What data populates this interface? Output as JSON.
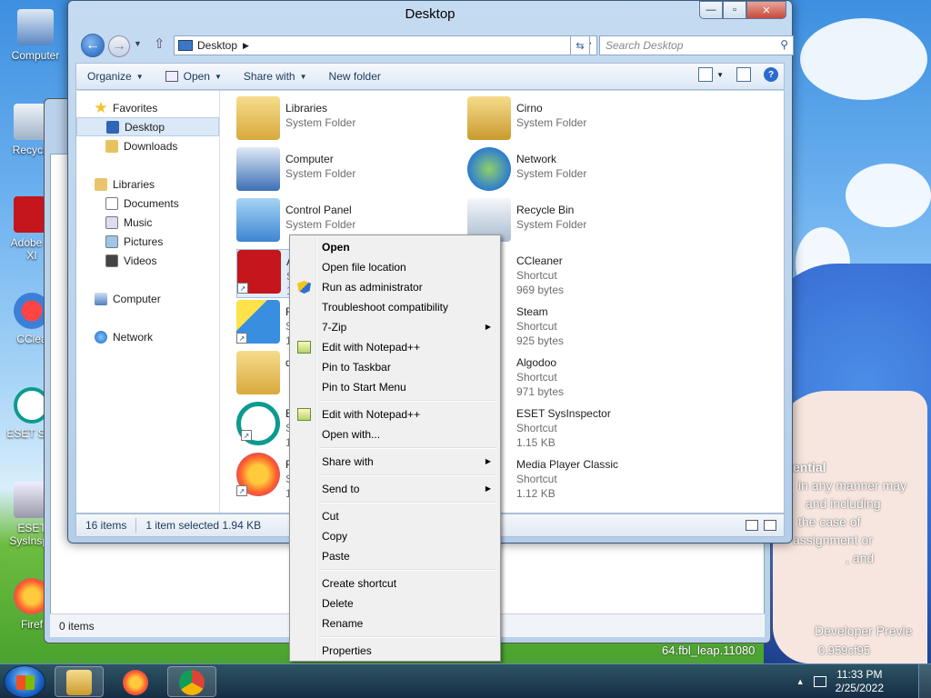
{
  "window": {
    "title": "Desktop",
    "address": "Desktop",
    "search_placeholder": "Search Desktop"
  },
  "toolbar": {
    "organize": "Organize",
    "open": "Open",
    "share_with": "Share with",
    "new_folder": "New folder"
  },
  "nav": {
    "favorites": "Favorites",
    "desktop": "Desktop",
    "downloads": "Downloads",
    "libraries": "Libraries",
    "documents": "Documents",
    "music": "Music",
    "pictures": "Pictures",
    "videos": "Videos",
    "computer": "Computer",
    "network": "Network"
  },
  "files": [
    {
      "name": "Libraries",
      "type": "System Folder",
      "size": ""
    },
    {
      "name": "Cirno",
      "type": "System Folder",
      "size": ""
    },
    {
      "name": "Computer",
      "type": "System Folder",
      "size": ""
    },
    {
      "name": "Network",
      "type": "System Folder",
      "size": ""
    },
    {
      "name": "Control Panel",
      "type": "System Folder",
      "size": ""
    },
    {
      "name": "Recycle Bin",
      "type": "System Folder",
      "size": ""
    },
    {
      "name": "A",
      "type": "S",
      "size": "1"
    },
    {
      "name": "CCleaner",
      "type": "Shortcut",
      "size": "969 bytes"
    },
    {
      "name": "F",
      "type": "S",
      "size": "1"
    },
    {
      "name": "Steam",
      "type": "Shortcut",
      "size": "925 bytes"
    },
    {
      "name": "d",
      "type": "",
      "size": ""
    },
    {
      "name": "Algodoo",
      "type": "Shortcut",
      "size": "971 bytes"
    },
    {
      "name": "E",
      "type": "S",
      "size": "1"
    },
    {
      "name": "ESET SysInspector",
      "type": "Shortcut",
      "size": "1.15 KB"
    },
    {
      "name": "F",
      "type": "S",
      "size": "1"
    },
    {
      "name": "Media Player Classic",
      "type": "Shortcut",
      "size": "1.12 KB"
    }
  ],
  "status": {
    "items": "16 items",
    "selected": "1 item selected  1.94 KB"
  },
  "back_window": {
    "status": "0 items"
  },
  "context_menu": {
    "open": "Open",
    "open_file_location": "Open file location",
    "run_as_admin": "Run as administrator",
    "troubleshoot": "Troubleshoot compatibility",
    "seven_zip": "7-Zip",
    "edit_notepad1": "Edit with Notepad++",
    "pin_taskbar": "Pin to Taskbar",
    "pin_start": "Pin to Start Menu",
    "edit_notepad2": "Edit with Notepad++",
    "open_with": "Open with...",
    "share_with": "Share with",
    "send_to": "Send to",
    "cut": "Cut",
    "copy": "Copy",
    "paste": "Paste",
    "create_shortcut": "Create shortcut",
    "delete": "Delete",
    "rename": "Rename",
    "properties": "Properties"
  },
  "desktop_icons": {
    "computer": "Computer",
    "recycle": "Recycle",
    "adobe1": "Adobe R",
    "adobe2": "XI",
    "ccleaner": "CClea",
    "eset": "ESET Sec",
    "eset_sys1": "ESET",
    "eset_sys2": "SysInspe",
    "firefox": "Firef"
  },
  "wallpaper_text": {
    "line1": "ential",
    "line2": "in any manner may",
    "line3": "and including",
    "line4": "the case of",
    "line5": "assignment or",
    "line6": ", and",
    "line7": "Developer Previe",
    "line8": "64.fbl_leap.11080",
    "line9": "0.959cf95"
  },
  "taskbar": {
    "time": "11:33 PM",
    "date": "2/25/2022"
  },
  "colors": {
    "accent": "#2a6bd0",
    "selection": "#dbe8f7"
  }
}
